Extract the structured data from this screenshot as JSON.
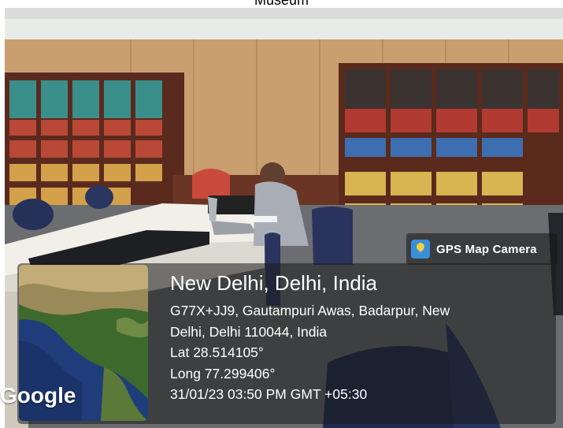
{
  "caption": "Museum",
  "gps_badge": {
    "label": "GPS Map Camera",
    "icon": "map-pin-icon"
  },
  "location": {
    "title": "New Delhi, Delhi, India",
    "address_line1": "G77X+JJ9, Gautampuri Awas, Badarpur, New",
    "address_line2": "Delhi, Delhi 110044, India",
    "latitude": "Lat 28.514105°",
    "longitude": "Long 77.299406°",
    "timestamp": "31/01/23 03:50 PM GMT +05:30"
  },
  "map": {
    "brand": "Google"
  }
}
